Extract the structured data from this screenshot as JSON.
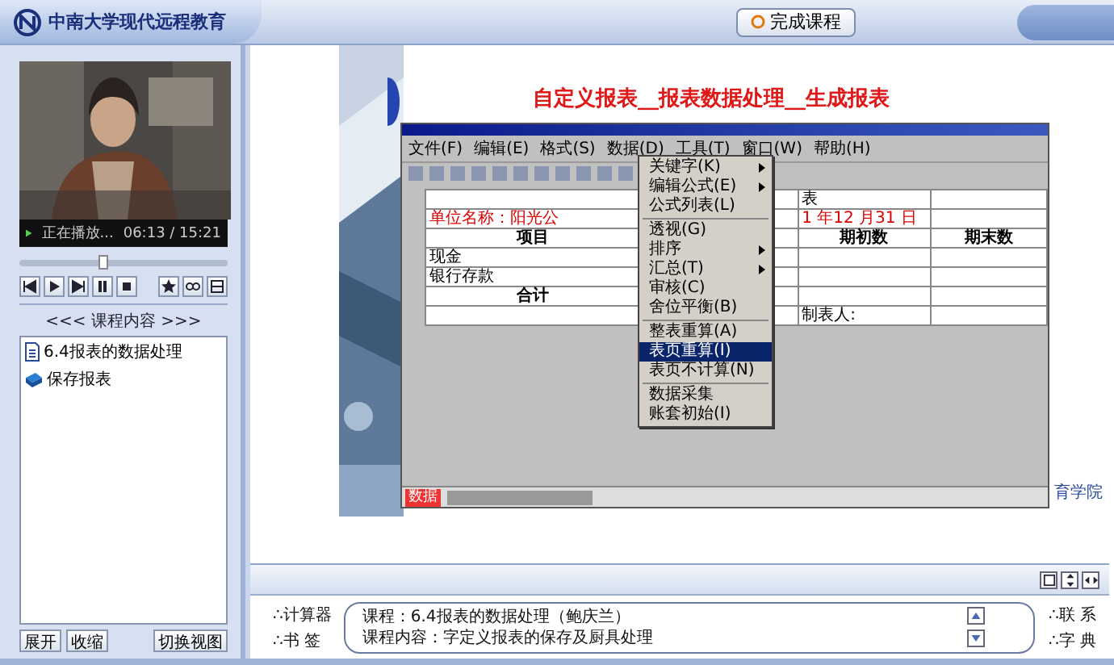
{
  "header": {
    "title": "中南大学现代远程教育",
    "finish_button": "完成课程"
  },
  "player": {
    "status": "正在播放...",
    "time": "06:13 / 15:21",
    "level": 0.4
  },
  "course_panel": {
    "title": "<<< 课程内容 >>>",
    "items": [
      {
        "label": "6.4报表的数据处理",
        "kind": "document"
      },
      {
        "label": "保存报表",
        "kind": "book"
      }
    ],
    "buttons": [
      "展开",
      "收缩",
      "切换视图"
    ]
  },
  "slide": {
    "title": "自定义报表__报表数据处理__生成报表",
    "menu_bar": [
      "文件(F)",
      "编辑(E)",
      "格式(S)",
      "数据(D)",
      "工具(T)",
      "窗口(W)",
      "帮助(H)"
    ],
    "menu_items": [
      {
        "label": "关键字(K)",
        "submenu": true,
        "selected": false
      },
      {
        "label": "编辑公式(E)",
        "submenu": true,
        "selected": false
      },
      {
        "label": "公式列表(L)",
        "submenu": false,
        "selected": false
      },
      {
        "label": "透视(G)",
        "submenu": false,
        "selected": false
      },
      {
        "label": "排序",
        "submenu": true,
        "selected": false
      },
      {
        "label": "汇总(T)",
        "submenu": true,
        "selected": false
      },
      {
        "label": "审核(C)",
        "submenu": false,
        "selected": false
      },
      {
        "label": "舍位平衡(B)",
        "submenu": false,
        "selected": false
      },
      {
        "label": "整表重算(A)",
        "submenu": false,
        "selected": false
      },
      {
        "label": "表页重算(I)",
        "submenu": false,
        "selected": true
      },
      {
        "label": "表页不计算(N)",
        "submenu": false,
        "selected": false
      },
      {
        "label": "数据采集",
        "submenu": false,
        "selected": false
      },
      {
        "label": "账套初始(I)",
        "submenu": false,
        "selected": false
      }
    ],
    "sheet_rows": [
      [
        "",
        "",
        "表",
        ""
      ],
      [
        "单位名称：阳光公",
        "",
        "1 年12 月31 日",
        ""
      ],
      [
        "项目",
        "",
        "期初数",
        "期末数"
      ],
      [
        "现金",
        "",
        "",
        ""
      ],
      [
        "银行存款",
        "",
        "",
        ""
      ],
      [
        "合计",
        "",
        "",
        ""
      ],
      [
        "",
        "",
        "制表人:",
        ""
      ]
    ],
    "mode": "数据",
    "footer": "育学院"
  },
  "info": {
    "tools_left": [
      "∴计算器",
      "∴书 签"
    ],
    "lines": [
      "课程：6.4报表的数据处理（鲍庆兰）",
      "课程内容：字定义报表的保存及厨具处理"
    ],
    "tools_right": [
      "∴联 系",
      "∴字 典"
    ]
  }
}
